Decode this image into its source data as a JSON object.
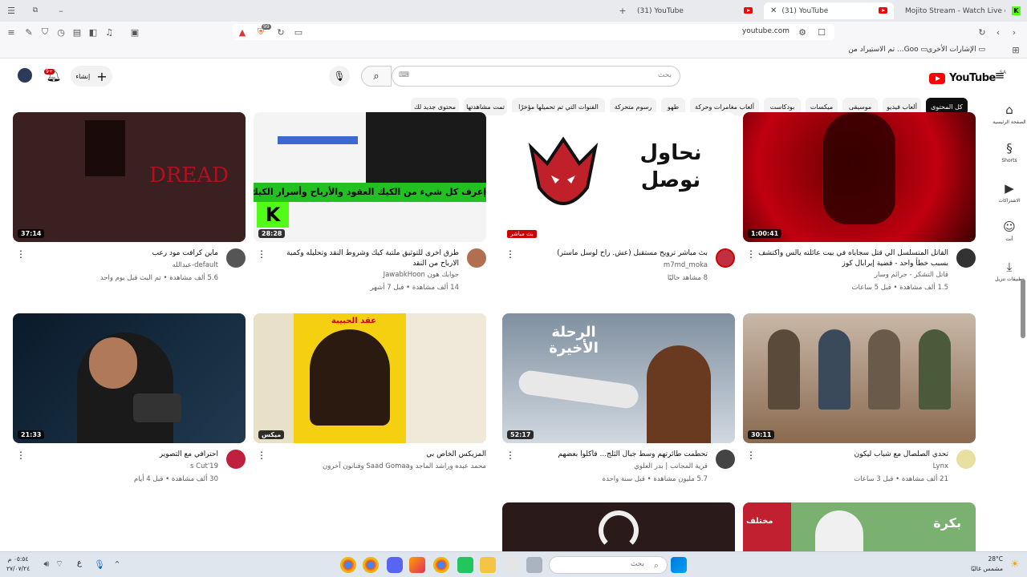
{
  "browser": {
    "tabs": [
      {
        "title": "(31) YouTube",
        "favicon": "youtube-icon"
      },
      {
        "title": "(31) YouTube",
        "favicon": "youtube-icon"
      },
      {
        "title": "Mojito Stream - Watch Live on Kick",
        "favicon": "kick-icon"
      }
    ],
    "new_tab_label": "+",
    "url": "youtube.com",
    "shields_count": "99",
    "bookmarks": [
      {
        "label": "الإشارات الأخرى"
      },
      {
        "label": "تم الاستيراد من ...Goo"
      }
    ]
  },
  "youtube": {
    "logo_text": "YouTube",
    "logo_region": "SA",
    "search_placeholder": "بحث",
    "create_label": "إنشاء",
    "notif_badge": "9+",
    "chips": [
      "كل المحتوى",
      "ألعاب فيديو",
      "موسيقى",
      "ميكسات",
      "بودكاست",
      "ألعاب مغامرات وحركة",
      "طهو",
      "رسوم متحركة",
      "الفنوات التي تم تحميلها مؤخرًا",
      "تمت مشاهدتها",
      "محتوى جديد لك"
    ],
    "sidebar": [
      {
        "label": "الصفحة الرئيسية",
        "icon": "home-icon"
      },
      {
        "label": "Shorts",
        "icon": "shorts-icon"
      },
      {
        "label": "الاشتراكات",
        "icon": "subscriptions-icon"
      },
      {
        "label": "أنت",
        "icon": "you-icon"
      },
      {
        "label": "تطبيقات تنزيل",
        "icon": "download-icon"
      }
    ],
    "videos": [
      {
        "title": "القاتل المتسلسل الي قتل سجاياه في بيت عائلته يالس واكتشف بسبب خطأ واحد - قضية إيرابال كوز",
        "channel": "قاتل التشكر - جرائم وسار",
        "views": "1.5 ألف مشاهدة • قبل 5 ساعات",
        "duration": "1:00:41",
        "thumb_text": ""
      },
      {
        "title": "بث مباشر ترويح مستقبل (عش. راح لوسل ماستر)",
        "channel": "m7md_moka",
        "views": "8 مشاهد حاليًا",
        "duration": "",
        "live": "بث مباشر",
        "thumb_text": "نحاول نوصل"
      },
      {
        "title": "طرق اخرى للتوثيق ملتبة كيك وشروط النقد وتحليله وكمية الارباح من النقد",
        "channel": "جوابك هون JawabkHoon",
        "views": "14 ألف مشاهدة • قبل 7 أشهر",
        "duration": "28:28",
        "thumb_text": "إعرف كل شيء من الكيك العقود والأرباح وأسرار الكيك"
      },
      {
        "title": "ماين كرافت مود رعب",
        "channel": "default-عبدالله",
        "views": "5.6 ألف مشاهدة • تم البث قبل يوم واحد",
        "duration": "37:14",
        "thumb_text": "DREAD"
      },
      {
        "title": "تحدي الصلصال مع شباب ليكون",
        "channel": "Lynx",
        "views": "21 ألف مشاهدة • قبل 3 ساعات",
        "duration": "30:11",
        "thumb_text": ""
      },
      {
        "title": "تحطمت طائرتهم وسط جبال الثلج... فأكلوا بعضهم",
        "channel": "قرية المجانب | بدر العلوي",
        "views": "5.7 مليون مشاهدة • قبل سنة واحدة",
        "duration": "52:17",
        "thumb_text": "الرحلة الأخيرة"
      },
      {
        "title": "المزيكس الخاص بي",
        "channel": "محمد عبده وراشد الماجد وSaad Gomaa وفنانون آخرون",
        "views": "",
        "duration": "",
        "mix": "ميكس",
        "thumb_text": "عقد الحبيبة"
      },
      {
        "title": "احترافي مع التصوير",
        "channel": "19's Cut",
        "views": "30 ألف مشاهدة • قبل 4 أيام",
        "duration": "21:33",
        "thumb_text": ""
      },
      {
        "title": "",
        "channel": "",
        "views": "",
        "duration": "",
        "thumb_text": "بكرة"
      },
      {
        "title": "",
        "channel": "",
        "views": "",
        "duration": "",
        "thumb_text": "مختلف"
      }
    ]
  },
  "taskbar": {
    "search_placeholder": "بحث",
    "weather_temp": "28°C",
    "weather_text": "مشمس غالبًا",
    "time": "٠٥:٥٤ م",
    "date": "٢٧/٠٧/٢٤",
    "lang": "ع"
  },
  "colors": {
    "youtube_red": "#ff0000",
    "chip_active": "#0f0f0f",
    "live_red": "#cc0000"
  }
}
